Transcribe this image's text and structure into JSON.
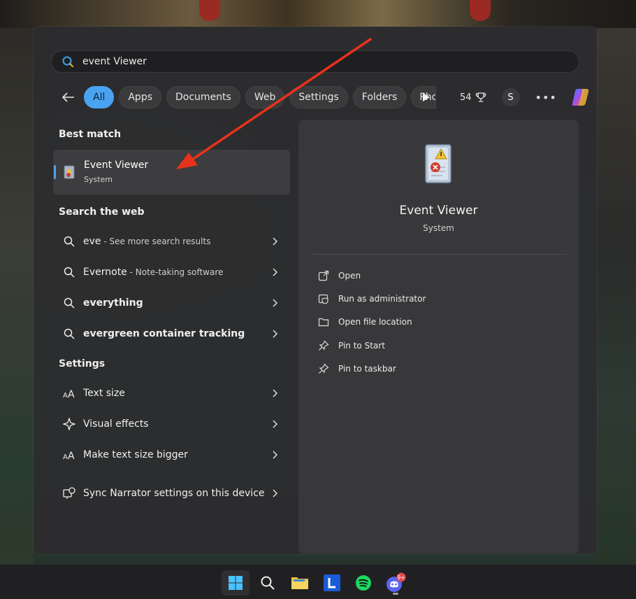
{
  "search": {
    "value": "event Viewer"
  },
  "filters": {
    "chips": [
      "All",
      "Apps",
      "Documents",
      "Web",
      "Settings",
      "Folders",
      "Pho"
    ],
    "active": "All",
    "points": "54",
    "avatar": "S"
  },
  "left": {
    "best_match_heading": "Best match",
    "best": {
      "title": "Event Viewer",
      "subtitle": "System"
    },
    "web_heading": "Search the web",
    "web": [
      {
        "main": "eve",
        "sub": " - See more search results"
      },
      {
        "main": "Evernote",
        "sub": " - Note-taking software"
      },
      {
        "main": "everything",
        "sub": ""
      },
      {
        "main": "evergreen container tracking",
        "sub": ""
      }
    ],
    "settings_heading": "Settings",
    "settings": [
      {
        "label": "Text size",
        "icon": "text-size-icon"
      },
      {
        "label": "Visual effects",
        "icon": "visual-effects-icon"
      },
      {
        "label": "Make text size bigger",
        "icon": "text-size-icon"
      },
      {
        "label": "Sync Narrator settings on this device",
        "icon": "narrator-sync-icon"
      }
    ]
  },
  "preview": {
    "title": "Event Viewer",
    "subtitle": "System",
    "actions": [
      "Open",
      "Run as administrator",
      "Open file location",
      "Pin to Start",
      "Pin to taskbar"
    ]
  },
  "taskbar": {
    "items": [
      "start-icon",
      "search-icon",
      "file-explorer-icon",
      "l-app-icon",
      "spotify-icon",
      "discord-icon"
    ],
    "discord_badge": "9+"
  },
  "colors": {
    "accent": "#4aa3f0",
    "annotation_arrow": "#e8321c"
  }
}
